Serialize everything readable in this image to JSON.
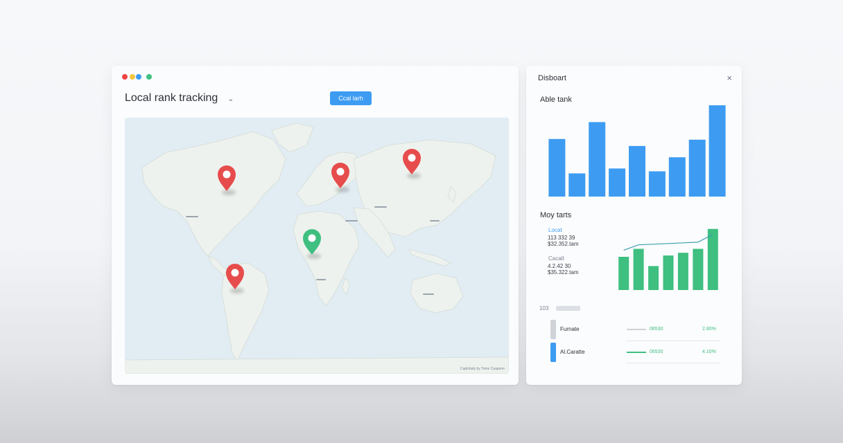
{
  "left_window": {
    "title": "Local rank tracking",
    "action_button": "Ccal larh",
    "window_dots": [
      "#ef4444",
      "#f5c542",
      "#3d9cf2",
      "#3fbf80"
    ]
  },
  "map": {
    "attribution": "Caplobaly by Tome Caapone",
    "pins": [
      {
        "name": "north-america",
        "color": "#e74c4c"
      },
      {
        "name": "europe",
        "color": "#e74c4c"
      },
      {
        "name": "asia",
        "color": "#e74c4c"
      },
      {
        "name": "africa",
        "color": "#3fbf80"
      },
      {
        "name": "south-america",
        "color": "#e74c4c"
      }
    ]
  },
  "right_window": {
    "title": "Disboart",
    "close_label": "×",
    "section1_title": "Able tank",
    "bar_chart": {
      "type": "bar",
      "values": [
        82,
        33,
        106,
        40,
        72,
        36,
        56,
        81,
        130
      ],
      "ylim": [
        0,
        135
      ],
      "color": "#3d9cf2"
    },
    "section2_title": "Moy tarts",
    "stats": [
      {
        "label": "Locat",
        "line1": "113 332 39",
        "line2": "$32.352.tam"
      },
      {
        "label": "Cacalt",
        "line1": "4.2.42 30",
        "line2": "$35.322.tam"
      }
    ],
    "green_chart": {
      "type": "bar",
      "values": [
        50,
        62,
        36,
        52,
        56,
        62,
        92
      ],
      "trend": [
        60,
        68,
        69,
        70,
        71,
        72,
        84
      ],
      "ylim": [
        0,
        100
      ],
      "color": "#3fbf80"
    },
    "table_header": "103",
    "table_rows": [
      {
        "label": "Furnate",
        "value": "06530",
        "percent": "2.80%",
        "marker_color": "#cfd3d8"
      },
      {
        "label": "Al.Caratte",
        "value": "06530",
        "percent": "4.10%",
        "marker_color": "#3d9cf2"
      }
    ]
  }
}
